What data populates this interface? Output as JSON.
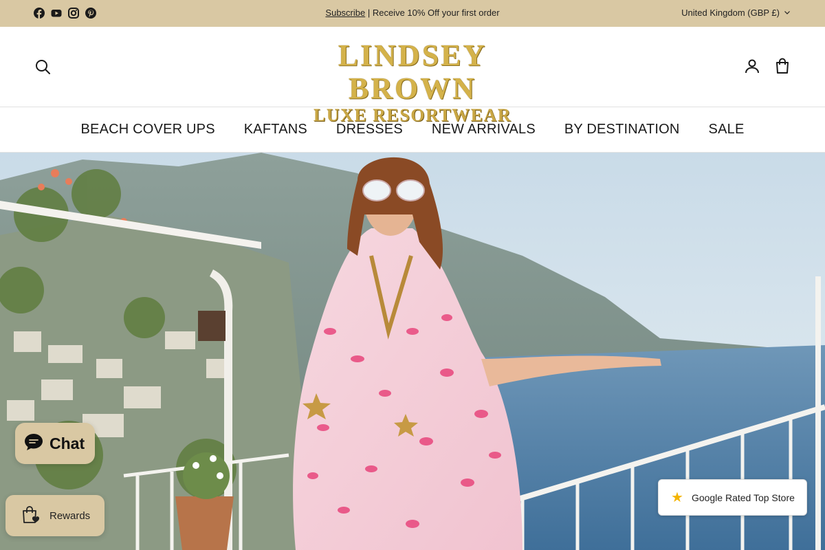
{
  "announcement": {
    "social_icons": [
      "facebook-icon",
      "youtube-icon",
      "instagram-icon",
      "pinterest-icon"
    ],
    "subscribe_link": "Subscribe",
    "message": " | Receive 10% Off your first order",
    "region": "United Kingdom (GBP £)",
    "background": "#d9c8a3"
  },
  "header": {
    "logo_line1": "LINDSEY BROWN",
    "logo_line2": "LUXE RESORTWEAR",
    "logo_color": "#d4b24a",
    "icons": [
      "search-icon",
      "account-icon",
      "cart-icon"
    ]
  },
  "nav": {
    "items": [
      "BEACH COVER UPS",
      "KAFTANS",
      "DRESSES",
      "NEW ARRIVALS",
      "BY DESTINATION",
      "SALE"
    ]
  },
  "widgets": {
    "chat_label": "Chat",
    "rewards_label": "Rewards",
    "google_label": "Google Rated Top Store"
  }
}
